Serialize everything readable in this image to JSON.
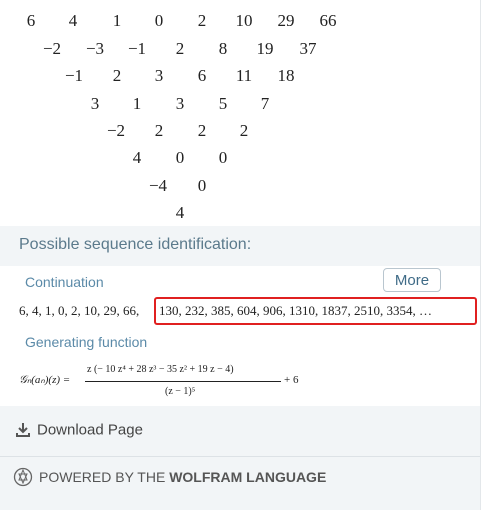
{
  "difference_table": {
    "rows": [
      [
        "6",
        "4",
        "1",
        "0",
        "2",
        "10",
        "29",
        "66"
      ],
      [
        "−2",
        "−3",
        "−1",
        "2",
        "8",
        "19",
        "37"
      ],
      [
        "−1",
        "2",
        "3",
        "6",
        "11",
        "18"
      ],
      [
        "3",
        "1",
        "3",
        "5",
        "7"
      ],
      [
        "−2",
        "2",
        "2",
        "2"
      ],
      [
        "4",
        "0",
        "0"
      ],
      [
        "−4",
        "0"
      ],
      [
        "4"
      ]
    ]
  },
  "identification": {
    "title": "Possible sequence identification:",
    "continuation_label": "Continuation",
    "more_button": "More",
    "sequence_known": "6, 4, 1, 0, 2, 10, 29, 66,",
    "sequence_continuation": "130, 232, 385, 604, 906, 1310, 1837, 2510, 3354, …",
    "generating_function_label": "Generating function",
    "formula": {
      "lhs": "𝒢ₙ(aₙ)(z) =",
      "numerator": "z (− 10 z⁴ + 28 z³ − 35 z² + 19 z − 4)",
      "denominator": "(z − 1)⁵",
      "rhs": "+ 6"
    }
  },
  "footer": {
    "download_label": "Download Page",
    "powered_prefix": "POWERED BY THE ",
    "powered_brand": "WOLFRAM LANGUAGE"
  },
  "icons": {
    "download": "download-icon",
    "wolfram": "wolfram-logo-icon"
  },
  "colors": {
    "highlight_border": "#e02020",
    "label_blue": "#5b8aa8",
    "panel_bg": "#f2f5f7"
  }
}
